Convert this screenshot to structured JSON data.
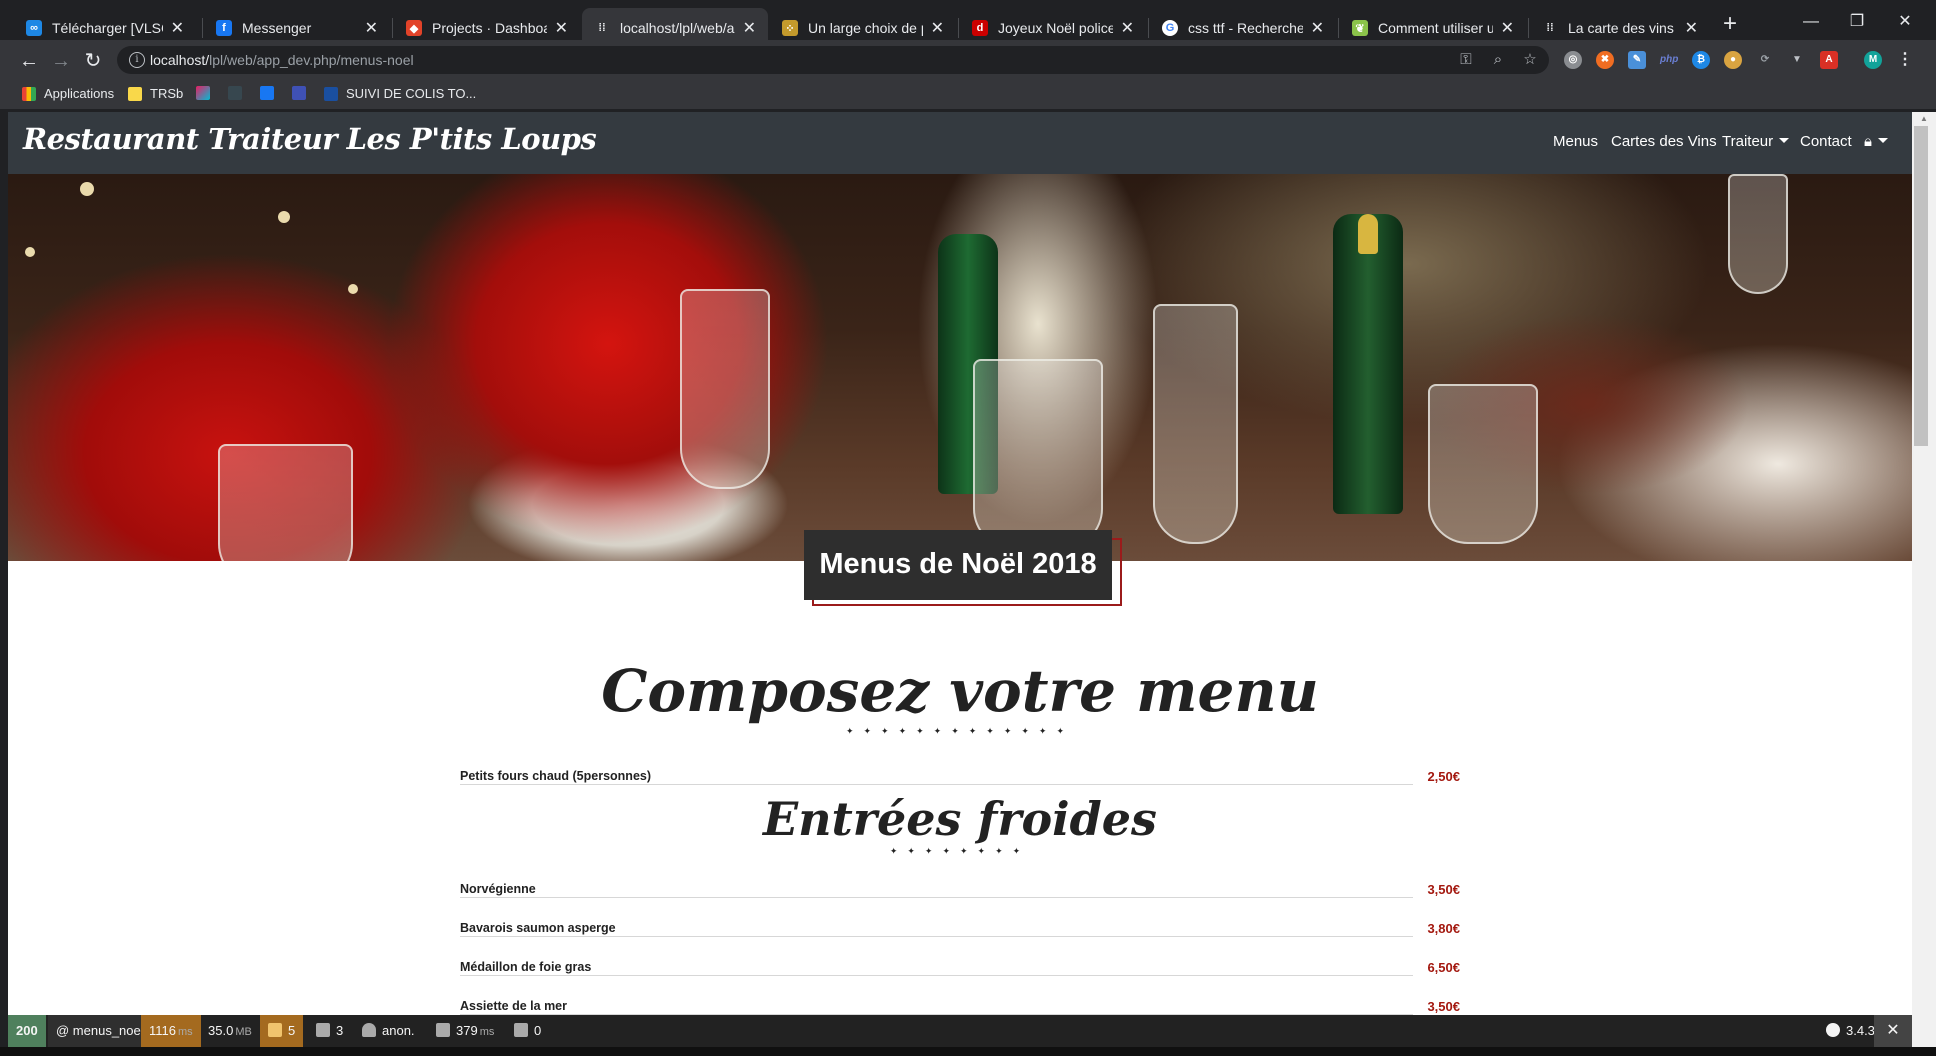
{
  "browser": {
    "tabs": [
      {
        "title": "Télécharger [VLSC] Mic",
        "favicon": "vlsc-icon",
        "color": "#34a853",
        "active": false
      },
      {
        "title": "Messenger",
        "favicon": "facebook-icon",
        "color": "#1877f2",
        "active": false
      },
      {
        "title": "Projects · Dashboard · G",
        "favicon": "gitlab-icon",
        "color": "#e24329",
        "active": false
      },
      {
        "title": "localhost/lpl/web/app_",
        "favicon": "fork-knife-icon",
        "color": "#e8eaed",
        "active": true
      },
      {
        "title": "Un large choix de polic",
        "favicon": "dafont-icon",
        "color": "#c49a2c",
        "active": false
      },
      {
        "title": "Joyeux Noël police | da",
        "favicon": "dafont-red-icon",
        "color": "#cc0000",
        "active": false
      },
      {
        "title": "css ttf - Recherche Goo",
        "favicon": "google-icon",
        "color": "#4285f4",
        "active": false
      },
      {
        "title": "Comment utiliser une f",
        "favicon": "leaf-icon",
        "color": "#8bc34a",
        "active": false
      },
      {
        "title": "La carte des vins du Re",
        "favicon": "fork-knife-icon",
        "color": "#e8eaed",
        "active": false
      }
    ],
    "url": {
      "host": "localhost/",
      "path": "lpl/web/app_dev.php/menus-noel"
    },
    "bookmarks": [
      {
        "label": "Applications",
        "icon": "apps-grid-icon",
        "color": "#ea4335"
      },
      {
        "label": "TRSb",
        "icon": "folder-icon",
        "color": "#f9d84a"
      },
      {
        "label": "",
        "icon": "colorful-logo-icon",
        "color": "#e91e63"
      },
      {
        "label": "",
        "icon": "download-icon",
        "color": "#37474f"
      },
      {
        "label": "",
        "icon": "facebook-icon",
        "color": "#1877f2"
      },
      {
        "label": "",
        "icon": "tool-icon",
        "color": "#3f51b5"
      },
      {
        "label": "SUIVI DE COLIS TO...",
        "icon": "parcel-17-icon",
        "color": "#1a4fa0"
      }
    ],
    "profile_initial": "M"
  },
  "site": {
    "brand": "Restaurant Traiteur Les P'tits Loups",
    "nav": [
      {
        "label": "Menus",
        "dropdown": false
      },
      {
        "label": "Cartes des Vins",
        "dropdown": false
      },
      {
        "label": "Traiteur",
        "dropdown": true
      },
      {
        "label": "Contact",
        "dropdown": false
      }
    ],
    "page_title": "Menus de Noël 2018",
    "section_title": "Composez votre menu",
    "intro_item": {
      "name": "Petits fours chaud (5personnes)",
      "price": "2,50€"
    },
    "category_title": "Entrées froides",
    "items": [
      {
        "name": "Norvégienne",
        "price": "3,50€"
      },
      {
        "name": "Bavarois saumon asperge",
        "price": "3,80€"
      },
      {
        "name": "Médaillon de foie gras",
        "price": "6,50€"
      },
      {
        "name": "Assiette de la mer",
        "price": "3,50€"
      }
    ],
    "accent_color": "#a3180f"
  },
  "debug_toolbar": {
    "status": "200",
    "route": "@ menus_noel",
    "time": "1116",
    "time_unit": "ms",
    "memory": "35.0",
    "memory_unit": "MB",
    "logs": "5",
    "translations": "3",
    "user": "anon.",
    "db_time": "379",
    "db_unit": "ms",
    "forms": "0",
    "version": "3.4.3"
  }
}
